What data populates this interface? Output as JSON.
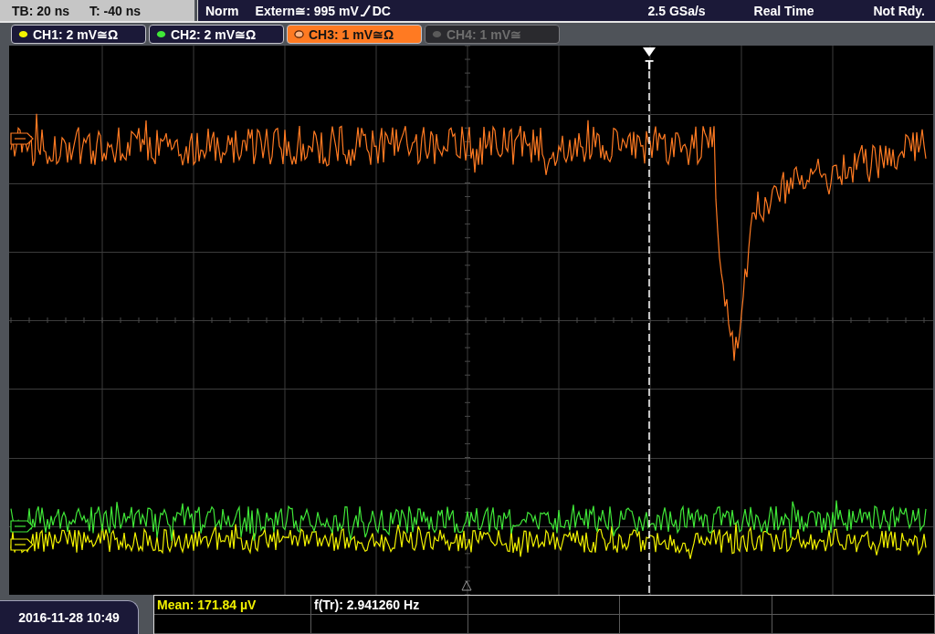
{
  "status_bar": {
    "timebase": "TB: 20 ns",
    "trigger_offset": "T: -40 ns",
    "trigger_mode": "Norm",
    "trigger_level": "Extern≅: 995 mV",
    "trigger_coupling": "DC",
    "sample_rate": "2.5 GSa/s",
    "acquisition_mode": "Real Time",
    "status": "Not Rdy."
  },
  "channels": [
    {
      "label": "CH1: 2 mV≅Ω",
      "color": "#f2f200",
      "selected": false,
      "on": true
    },
    {
      "label": "CH2: 2 mV≅Ω",
      "color": "#40e838",
      "selected": false,
      "on": true
    },
    {
      "label": "CH3: 1 mV≅Ω",
      "color": "#ff7a22",
      "selected": true,
      "on": true
    },
    {
      "label": "CH4: 1 mV≅",
      "color": "#5a5a5a",
      "selected": false,
      "on": false
    }
  ],
  "display": {
    "trigger_marker": "T"
  },
  "measurements": [
    {
      "text": "Mean: 171.84 µV",
      "color": "#f2f200"
    },
    {
      "text": "f(Tr): 2.941260 Hz",
      "color": "#ffffff"
    }
  ],
  "datetime": "2016-11-28 10:49"
}
